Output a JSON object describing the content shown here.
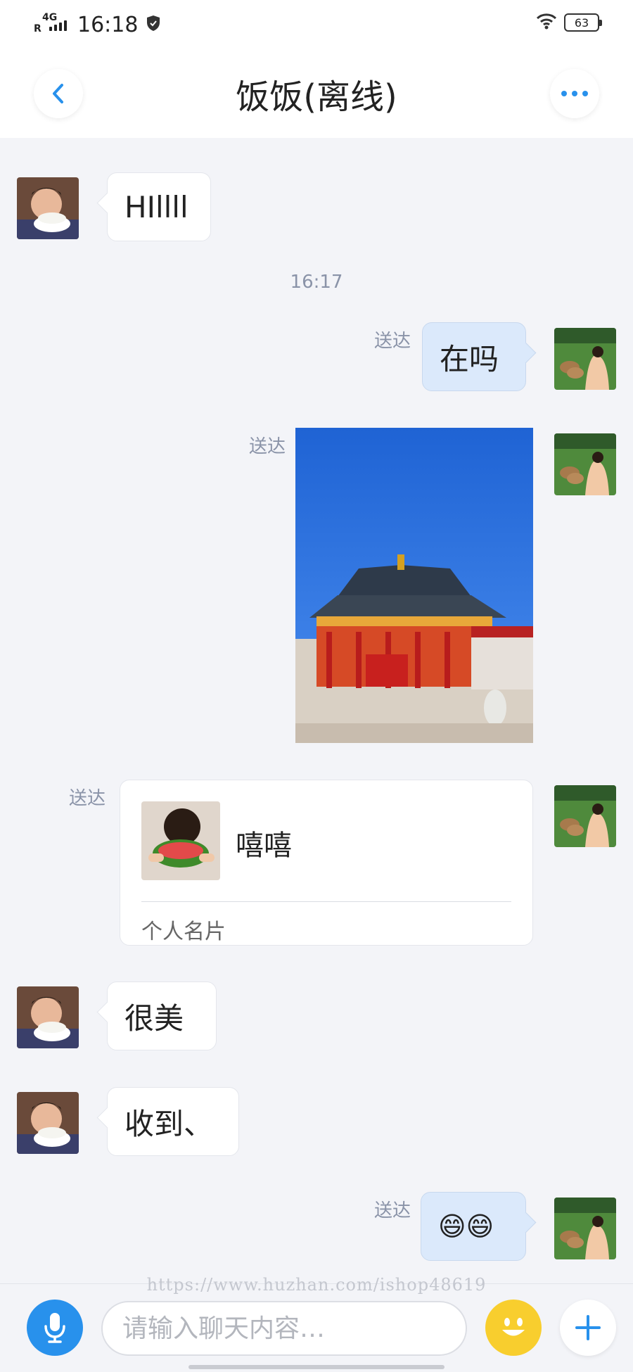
{
  "status_bar": {
    "network": "4G",
    "roaming": "R",
    "time": "16:18",
    "battery": "63"
  },
  "header": {
    "title": "饭饭(离线)"
  },
  "colors": {
    "accent": "#2891ec",
    "outgoing_bubble": "#dbe9fb",
    "incoming_bubble": "#ffffff",
    "background": "#f3f4f8"
  },
  "messages": [
    {
      "direction": "in",
      "type": "text",
      "text": "HIllll"
    },
    {
      "type": "timestamp",
      "text": "16:17"
    },
    {
      "direction": "out",
      "type": "text",
      "text": "在吗",
      "status": "送达"
    },
    {
      "direction": "out",
      "type": "image",
      "status": "送达"
    },
    {
      "direction": "out",
      "type": "card",
      "status": "送达",
      "card_name": "嘻嘻",
      "card_type": "个人名片"
    },
    {
      "direction": "in",
      "type": "text",
      "text": "很美"
    },
    {
      "direction": "in",
      "type": "text",
      "text": "收到、"
    },
    {
      "direction": "out",
      "type": "text",
      "text": "😄😄",
      "status": "送达"
    }
  ],
  "watermark": "https://www.huzhan.com/ishop48619",
  "input": {
    "placeholder": "请输入聊天内容…"
  }
}
